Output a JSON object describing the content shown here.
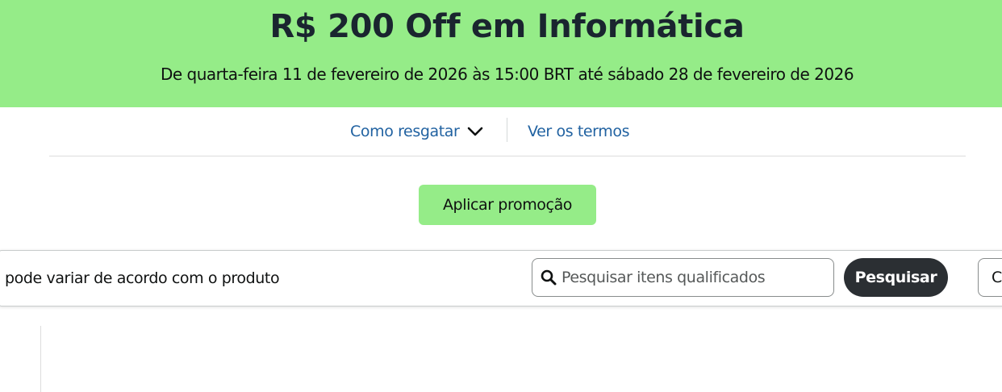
{
  "banner": {
    "title": "R$ 200 Off em Informática",
    "dates": "De quarta-feira 11 de fevereiro de 2026 às 15:00 BRT até sábado 28 de fevereiro de 2026",
    "background": "#95ec88"
  },
  "links": {
    "how_to_redeem": "Como resgatar",
    "how_to_redeem_icon": "chevron-down-icon",
    "terms": "Ver os termos",
    "color": "#2162a1"
  },
  "apply_button": {
    "label": "Aplicar promoção"
  },
  "toolbar": {
    "note": "pode variar de acordo com o produto",
    "search": {
      "placeholder": "Pesquisar itens qualificados",
      "value": "",
      "icon": "search-icon"
    },
    "search_button": "Pesquisar",
    "cutoff_button": "C"
  }
}
